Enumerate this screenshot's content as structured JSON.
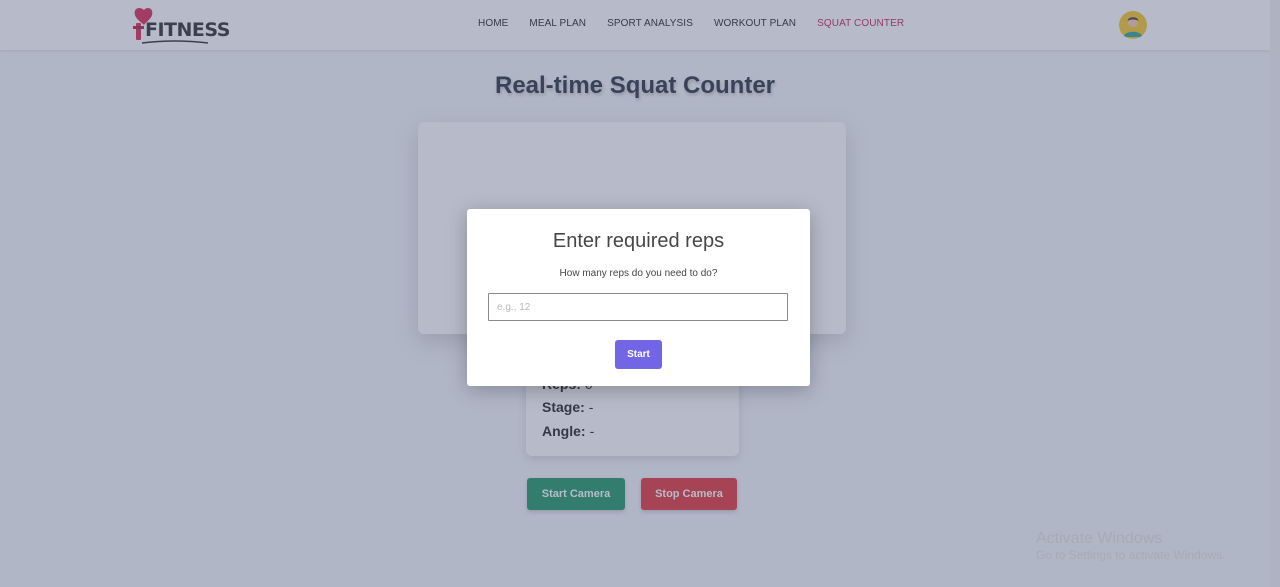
{
  "brand": {
    "name": "FITNESS"
  },
  "nav": {
    "links": [
      {
        "label": "HOME"
      },
      {
        "label": "MEAL PLAN"
      },
      {
        "label": "SPORT ANALYSIS"
      },
      {
        "label": "WORKOUT PLAN"
      },
      {
        "label": "SQUAT COUNTER",
        "active": true
      }
    ]
  },
  "page": {
    "title": "Real-time Squat Counter"
  },
  "stats": {
    "reps_label": "Reps:",
    "reps_value": "0",
    "stage_label": "Stage:",
    "stage_value": "-",
    "angle_label": "Angle:",
    "angle_value": "-"
  },
  "controls": {
    "start_label": "Start Camera",
    "stop_label": "Stop Camera"
  },
  "modal": {
    "title": "Enter required reps",
    "text": "How many reps do you need to do?",
    "input_placeholder": "e.g., 12",
    "input_value": "",
    "submit_label": "Start"
  },
  "watermark": {
    "title": "Activate Windows",
    "subtitle": "Go to Settings to activate Windows."
  },
  "colors": {
    "nav_active": "#c21048",
    "start_button": "#0d8f5a",
    "stop_button": "#e0262b",
    "modal_button": "#7366e6",
    "avatar_bg": "#f5c518"
  }
}
